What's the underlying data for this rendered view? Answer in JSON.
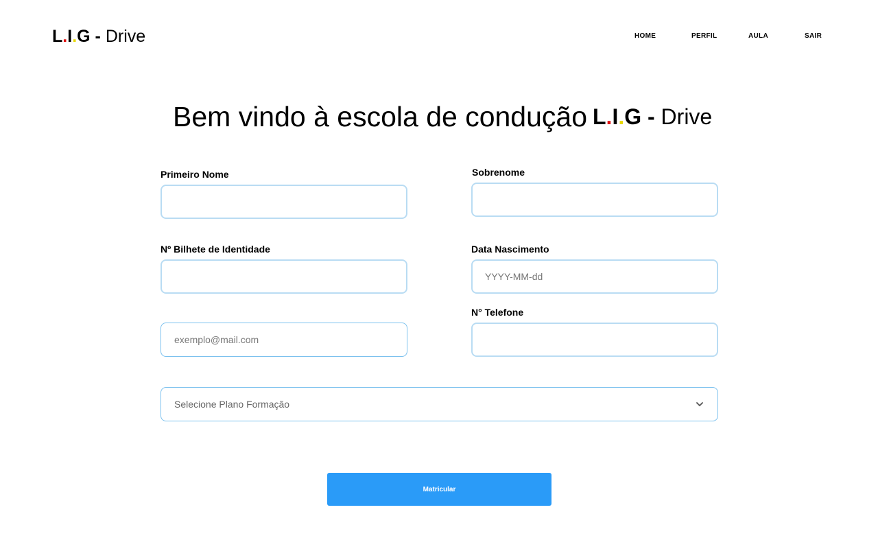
{
  "header": {
    "logo": {
      "l": "L",
      "dot1": ".",
      "i": "I",
      "dot2": ".",
      "g": "G",
      "dash": " - ",
      "drive": "Drive"
    },
    "nav": [
      {
        "label": "HOME"
      },
      {
        "label": "PERFIL"
      },
      {
        "label": "AULA"
      },
      {
        "label": "SAIR"
      }
    ]
  },
  "main": {
    "title": "Bem vindo à escola de condução",
    "title_logo": {
      "l": "L",
      "dot1": ".",
      "i": "I",
      "dot2": ".",
      "g": "G",
      "dash": " - ",
      "drive": "Drive"
    }
  },
  "form": {
    "first_name": {
      "label": "Primeiro Nome",
      "value": ""
    },
    "last_name": {
      "label": "Sobrenome",
      "value": ""
    },
    "id_card": {
      "label": "Nº Bilhete de Identidade",
      "value": ""
    },
    "birth_date": {
      "label": "Data Nascimento",
      "placeholder": "YYYY-MM-dd",
      "value": ""
    },
    "email": {
      "placeholder": "exemplo@mail.com",
      "value": ""
    },
    "phone": {
      "label": "N° Telefone",
      "value": ""
    },
    "plan_select": {
      "selected": "Selecione Plano Formação"
    },
    "submit_label": "Matricular"
  },
  "colors": {
    "accent": "#2a9bf8",
    "field_border": "#b9dcf3",
    "logo_red": "#e01010",
    "logo_yellow": "#e8d800"
  },
  "icons": {
    "select_chevron": "chevron-down-icon"
  }
}
